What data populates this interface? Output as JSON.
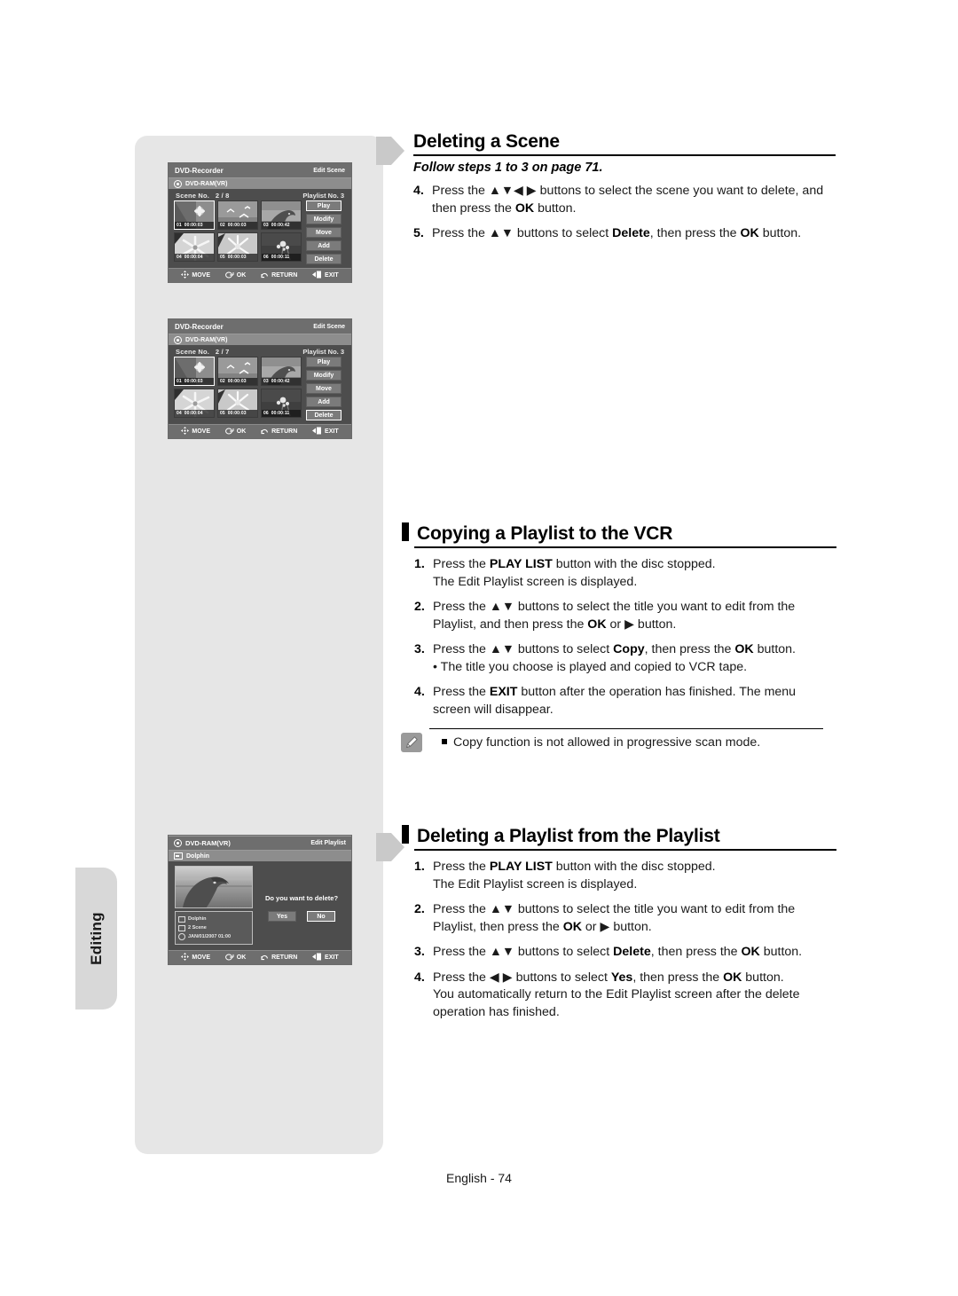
{
  "side_tab": {
    "label": "Editing"
  },
  "footer": {
    "page": "English - 74"
  },
  "sections": [
    {
      "id": "deleting-a-scene",
      "title": "Deleting a Scene",
      "has_bar": false,
      "subtitle": "Follow steps 1 to 3 on page 71.",
      "steps": [
        {
          "num": "4.",
          "html": "Press the ▲▼◀ ▶ buttons to select the scene you want to delete, and then press the <b>OK</b> button."
        },
        {
          "num": "5.",
          "html": "Press the ▲▼ buttons to select <b>Delete</b>, then press the <b>OK</b> button."
        }
      ]
    },
    {
      "id": "copying-a-playlist-to-the-vcr",
      "title": "Copying a Playlist to the VCR",
      "has_bar": true,
      "subtitle": "",
      "steps": [
        {
          "num": "1.",
          "html": "Press the <b>PLAY LIST</b> button with the disc stopped.<br>The Edit Playlist screen is displayed."
        },
        {
          "num": "2.",
          "html": "Press the ▲▼ buttons to select the title you want to edit from the Playlist, and then press the <b>OK</b> or ▶ button."
        },
        {
          "num": "3.",
          "html": "Press the ▲▼ buttons to select <b>Copy</b>, then press the <b>OK</b> button.<br>• The title you choose is played and copied to VCR tape."
        },
        {
          "num": "4.",
          "html": "Press the <b>EXIT</b> button after the operation has finished. The menu screen will disappear."
        }
      ]
    },
    {
      "id": "deleting-a-playlist-from-the-playlist",
      "title": "Deleting a Playlist from the Playlist",
      "has_bar": true,
      "subtitle": "",
      "steps": [
        {
          "num": "1.",
          "html": "Press the <b>PLAY LIST</b> button with the disc stopped.<br>The Edit Playlist screen is displayed."
        },
        {
          "num": "2.",
          "html": "Press the ▲▼ buttons to select the title you want to edit from the Playlist, then press the <b>OK</b> or ▶ button."
        },
        {
          "num": "3.",
          "html": "Press the ▲▼ buttons to select <b>Delete</b>, then press the <b>OK</b> button."
        },
        {
          "num": "4.",
          "html": "Press the ◀ ▶ buttons to select <b>Yes</b>, then press the <b>OK</b> button.<br>You automatically return to the Edit Playlist screen after the delete operation has finished."
        }
      ]
    }
  ],
  "note": {
    "icon": "pencil-icon",
    "bullet_text": "Copy function is not allowed in progressive scan mode."
  },
  "osd_common": {
    "footer": [
      {
        "icon": "move-pad-icon",
        "label": "MOVE"
      },
      {
        "icon": "ok-enter-icon",
        "label": "OK"
      },
      {
        "icon": "return-arrow-icon",
        "label": "RETURN"
      },
      {
        "icon": "exit-icon",
        "label": "EXIT"
      }
    ],
    "buttons": [
      "Play",
      "Modify",
      "Move",
      "Add",
      "Delete"
    ],
    "disc_label": "DVD-RAM(VR)"
  },
  "osd_screens": [
    {
      "name": "edit-scene-before-delete",
      "title_left": "DVD-Recorder",
      "title_right": "Edit Scene",
      "disc_label": "DVD-RAM(VR)",
      "scene_label": "Scene No.",
      "scene_value": "2 / 8",
      "playlist_label": "Playlist No.  3",
      "selected_button": "Play",
      "thumbs": [
        {
          "no": "01",
          "time": "00:00:03",
          "kind": "lotus",
          "selected": true
        },
        {
          "no": "02",
          "time": "00:00:03",
          "kind": "birds",
          "selected": false
        },
        {
          "no": "03",
          "time": "00:00:42",
          "kind": "dolphin",
          "selected": false
        },
        {
          "no": "04",
          "time": "00:00:04",
          "kind": "flower1",
          "selected": false
        },
        {
          "no": "05",
          "time": "00:00:03",
          "kind": "flower2",
          "selected": false
        },
        {
          "no": "06",
          "time": "00:00:11",
          "kind": "blossom",
          "selected": false
        }
      ]
    },
    {
      "name": "edit-scene-after-delete",
      "title_left": "DVD-Recorder",
      "title_right": "Edit Scene",
      "disc_label": "DVD-RAM(VR)",
      "scene_label": "Scene No.",
      "scene_value": "2 / 7",
      "playlist_label": "Playlist No.  3",
      "selected_button": "Delete",
      "thumbs": [
        {
          "no": "01",
          "time": "00:00:03",
          "kind": "lotus",
          "selected": true
        },
        {
          "no": "02",
          "time": "00:00:03",
          "kind": "birds",
          "selected": false
        },
        {
          "no": "03",
          "time": "00:00:42",
          "kind": "dolphin",
          "selected": false
        },
        {
          "no": "04",
          "time": "00:00:04",
          "kind": "flower1",
          "selected": false
        },
        {
          "no": "05",
          "time": "00:00:03",
          "kind": "flower2",
          "selected": false
        },
        {
          "no": "06",
          "time": "00:00:11",
          "kind": "blossom",
          "selected": false
        }
      ]
    }
  ],
  "osd_dialog": {
    "name": "edit-playlist-delete-confirm",
    "title_left": "DVD-RAM(VR)",
    "title_right": "Edit Playlist",
    "subtitle": "Dolphin",
    "info": [
      {
        "icon": "title-icon",
        "text": "Dolphin"
      },
      {
        "icon": "scene-icon",
        "text": "2 Scene"
      },
      {
        "icon": "clock-icon",
        "text": "JAN/01/2007 01:00"
      }
    ],
    "question": "Do you want to delete?",
    "buttons": [
      {
        "label": "Yes",
        "selected": false
      },
      {
        "label": "No",
        "selected": true
      }
    ]
  }
}
